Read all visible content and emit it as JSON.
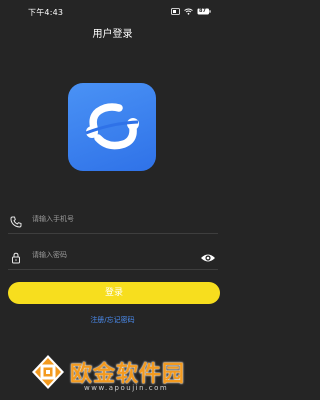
{
  "status_bar": {
    "time": "下午4:43",
    "battery": "87",
    "icons": [
      "sim-icon",
      "wifi-icon",
      "battery-icon"
    ]
  },
  "header": {
    "title": "用户登录"
  },
  "logo": {
    "icon": "app-logo",
    "colors": [
      "#4a92f5",
      "#2f72e8"
    ]
  },
  "form": {
    "phone": {
      "icon": "phone-icon",
      "placeholder": "请输入手机号",
      "value": ""
    },
    "password": {
      "icon": "lock-icon",
      "placeholder": "请输入密码",
      "value": "",
      "toggle_icon": "eye-icon"
    },
    "login_label": "登录",
    "register_link": "注册/忘记密码"
  },
  "watermark": {
    "text": "欧金软件园",
    "url": "www.apoujin.com"
  },
  "colors": {
    "background": "#252525",
    "accent": "#f7de1e",
    "link": "#4b8df2",
    "watermark": "#f39a1f"
  }
}
